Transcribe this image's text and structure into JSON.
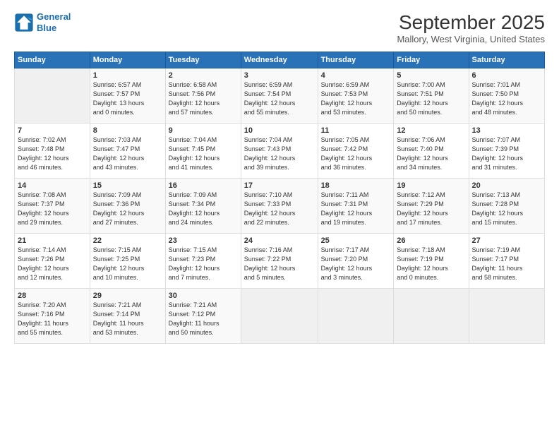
{
  "logo": {
    "line1": "General",
    "line2": "Blue"
  },
  "header": {
    "month": "September 2025",
    "location": "Mallory, West Virginia, United States"
  },
  "days_of_week": [
    "Sunday",
    "Monday",
    "Tuesday",
    "Wednesday",
    "Thursday",
    "Friday",
    "Saturday"
  ],
  "weeks": [
    [
      {
        "day": "",
        "info": ""
      },
      {
        "day": "1",
        "info": "Sunrise: 6:57 AM\nSunset: 7:57 PM\nDaylight: 13 hours\nand 0 minutes."
      },
      {
        "day": "2",
        "info": "Sunrise: 6:58 AM\nSunset: 7:56 PM\nDaylight: 12 hours\nand 57 minutes."
      },
      {
        "day": "3",
        "info": "Sunrise: 6:59 AM\nSunset: 7:54 PM\nDaylight: 12 hours\nand 55 minutes."
      },
      {
        "day": "4",
        "info": "Sunrise: 6:59 AM\nSunset: 7:53 PM\nDaylight: 12 hours\nand 53 minutes."
      },
      {
        "day": "5",
        "info": "Sunrise: 7:00 AM\nSunset: 7:51 PM\nDaylight: 12 hours\nand 50 minutes."
      },
      {
        "day": "6",
        "info": "Sunrise: 7:01 AM\nSunset: 7:50 PM\nDaylight: 12 hours\nand 48 minutes."
      }
    ],
    [
      {
        "day": "7",
        "info": "Sunrise: 7:02 AM\nSunset: 7:48 PM\nDaylight: 12 hours\nand 46 minutes."
      },
      {
        "day": "8",
        "info": "Sunrise: 7:03 AM\nSunset: 7:47 PM\nDaylight: 12 hours\nand 43 minutes."
      },
      {
        "day": "9",
        "info": "Sunrise: 7:04 AM\nSunset: 7:45 PM\nDaylight: 12 hours\nand 41 minutes."
      },
      {
        "day": "10",
        "info": "Sunrise: 7:04 AM\nSunset: 7:43 PM\nDaylight: 12 hours\nand 39 minutes."
      },
      {
        "day": "11",
        "info": "Sunrise: 7:05 AM\nSunset: 7:42 PM\nDaylight: 12 hours\nand 36 minutes."
      },
      {
        "day": "12",
        "info": "Sunrise: 7:06 AM\nSunset: 7:40 PM\nDaylight: 12 hours\nand 34 minutes."
      },
      {
        "day": "13",
        "info": "Sunrise: 7:07 AM\nSunset: 7:39 PM\nDaylight: 12 hours\nand 31 minutes."
      }
    ],
    [
      {
        "day": "14",
        "info": "Sunrise: 7:08 AM\nSunset: 7:37 PM\nDaylight: 12 hours\nand 29 minutes."
      },
      {
        "day": "15",
        "info": "Sunrise: 7:09 AM\nSunset: 7:36 PM\nDaylight: 12 hours\nand 27 minutes."
      },
      {
        "day": "16",
        "info": "Sunrise: 7:09 AM\nSunset: 7:34 PM\nDaylight: 12 hours\nand 24 minutes."
      },
      {
        "day": "17",
        "info": "Sunrise: 7:10 AM\nSunset: 7:33 PM\nDaylight: 12 hours\nand 22 minutes."
      },
      {
        "day": "18",
        "info": "Sunrise: 7:11 AM\nSunset: 7:31 PM\nDaylight: 12 hours\nand 19 minutes."
      },
      {
        "day": "19",
        "info": "Sunrise: 7:12 AM\nSunset: 7:29 PM\nDaylight: 12 hours\nand 17 minutes."
      },
      {
        "day": "20",
        "info": "Sunrise: 7:13 AM\nSunset: 7:28 PM\nDaylight: 12 hours\nand 15 minutes."
      }
    ],
    [
      {
        "day": "21",
        "info": "Sunrise: 7:14 AM\nSunset: 7:26 PM\nDaylight: 12 hours\nand 12 minutes."
      },
      {
        "day": "22",
        "info": "Sunrise: 7:15 AM\nSunset: 7:25 PM\nDaylight: 12 hours\nand 10 minutes."
      },
      {
        "day": "23",
        "info": "Sunrise: 7:15 AM\nSunset: 7:23 PM\nDaylight: 12 hours\nand 7 minutes."
      },
      {
        "day": "24",
        "info": "Sunrise: 7:16 AM\nSunset: 7:22 PM\nDaylight: 12 hours\nand 5 minutes."
      },
      {
        "day": "25",
        "info": "Sunrise: 7:17 AM\nSunset: 7:20 PM\nDaylight: 12 hours\nand 3 minutes."
      },
      {
        "day": "26",
        "info": "Sunrise: 7:18 AM\nSunset: 7:19 PM\nDaylight: 12 hours\nand 0 minutes."
      },
      {
        "day": "27",
        "info": "Sunrise: 7:19 AM\nSunset: 7:17 PM\nDaylight: 11 hours\nand 58 minutes."
      }
    ],
    [
      {
        "day": "28",
        "info": "Sunrise: 7:20 AM\nSunset: 7:16 PM\nDaylight: 11 hours\nand 55 minutes."
      },
      {
        "day": "29",
        "info": "Sunrise: 7:21 AM\nSunset: 7:14 PM\nDaylight: 11 hours\nand 53 minutes."
      },
      {
        "day": "30",
        "info": "Sunrise: 7:21 AM\nSunset: 7:12 PM\nDaylight: 11 hours\nand 50 minutes."
      },
      {
        "day": "",
        "info": ""
      },
      {
        "day": "",
        "info": ""
      },
      {
        "day": "",
        "info": ""
      },
      {
        "day": "",
        "info": ""
      }
    ]
  ]
}
